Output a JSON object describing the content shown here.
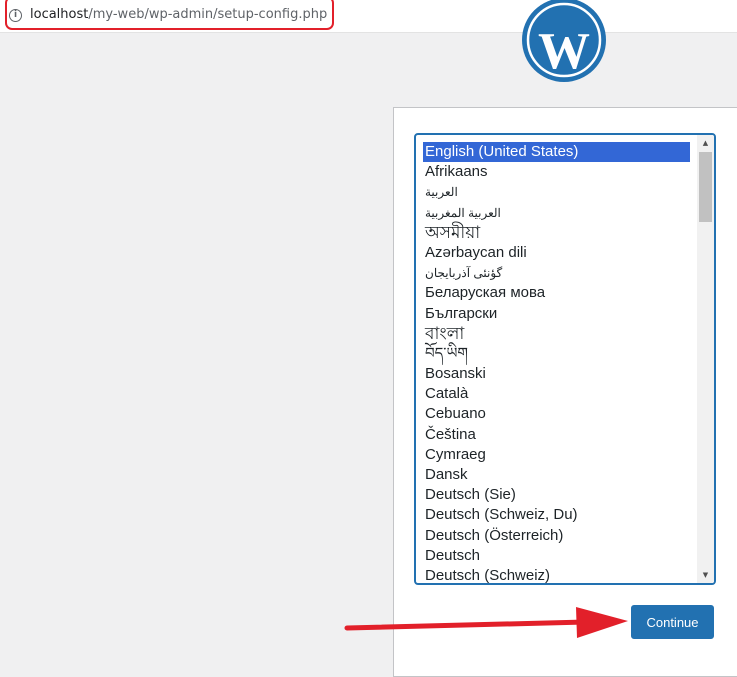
{
  "browser": {
    "url_host": "localhost",
    "url_path": "/my-web/wp-admin/setup-config.php",
    "info_icon": "info-icon"
  },
  "header": {
    "logo_icon": "wordpress-logo-icon",
    "brand_color": "#2271b1"
  },
  "language_select": {
    "selected_index": 0,
    "options": [
      "English (United States)",
      "Afrikaans",
      "العربية",
      "العربية المغربية",
      "অসমীয়া",
      "Azərbaycan dili",
      "گؤنئی آذربایجان",
      "Беларуская мова",
      "Български",
      "বাংলা",
      "བོད་ཡིག",
      "Bosanski",
      "Català",
      "Cebuano",
      "Čeština",
      "Cymraeg",
      "Dansk",
      "Deutsch (Sie)",
      "Deutsch (Schweiz, Du)",
      "Deutsch (Österreich)",
      "Deutsch",
      "Deutsch (Schweiz)"
    ]
  },
  "actions": {
    "continue_label": "Continue"
  },
  "annotation": {
    "arrow_color": "#e2202a"
  }
}
